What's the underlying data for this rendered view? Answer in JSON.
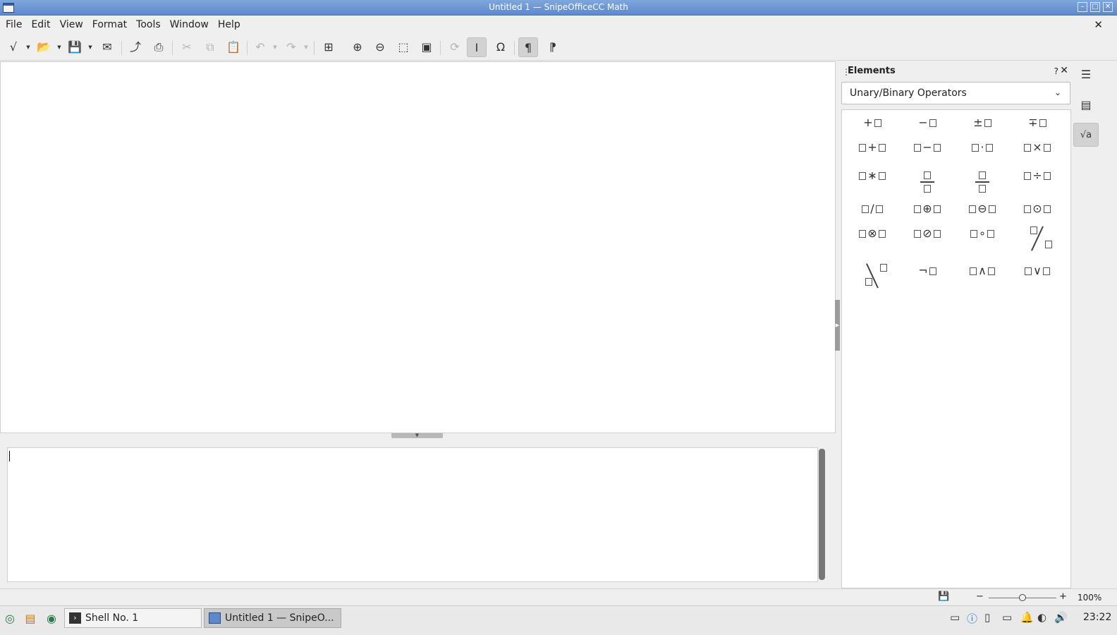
{
  "window": {
    "title": "Untitled 1 — SnipeOfficeCC Math",
    "minimize_icon": "minimize-icon",
    "maximize_icon": "maximize-icon",
    "close_icon": "close-icon"
  },
  "menu": {
    "items": [
      "File",
      "Edit",
      "View",
      "Format",
      "Tools",
      "Window",
      "Help"
    ],
    "close_document_glyph": "✕"
  },
  "toolbar": {
    "buttons": [
      {
        "name": "formula-icon",
        "glyph": "√"
      },
      {
        "name": "open-icon",
        "glyph": "📂"
      },
      {
        "name": "save-icon",
        "glyph": "💾"
      },
      {
        "name": "email-icon",
        "glyph": "✉"
      },
      {
        "name": "export-pdf-icon",
        "glyph": "⤴"
      },
      {
        "name": "print-icon",
        "glyph": "⎙"
      },
      {
        "name": "cut-icon",
        "glyph": "✂"
      },
      {
        "name": "copy-icon",
        "glyph": "⧉"
      },
      {
        "name": "paste-icon",
        "glyph": "📋"
      },
      {
        "name": "undo-icon",
        "glyph": "↶"
      },
      {
        "name": "redo-icon",
        "glyph": "↷"
      },
      {
        "name": "zoom-in-icon",
        "glyph": "⊕"
      },
      {
        "name": "zoom-out-icon",
        "glyph": "⊖"
      },
      {
        "name": "show-all-icon",
        "glyph": "⬚"
      },
      {
        "name": "fit-icon",
        "glyph": "▣"
      },
      {
        "name": "update-icon",
        "glyph": "⟳"
      },
      {
        "name": "formula-cursor-icon",
        "glyph": "I"
      },
      {
        "name": "symbols-icon",
        "glyph": "Ω"
      },
      {
        "name": "paragraph-ltr-icon",
        "glyph": "¶"
      },
      {
        "name": "paragraph-rtl-icon",
        "glyph": "¶"
      }
    ]
  },
  "elements_panel": {
    "grip": "⋮",
    "title": "Elements",
    "help": "?",
    "close": "✕",
    "category": "Unary/Binary Operators",
    "dropdown_arrow": "⌄",
    "operators": [
      {
        "kind": "unary",
        "op": "+"
      },
      {
        "kind": "unary",
        "op": "−"
      },
      {
        "kind": "unary",
        "op": "±"
      },
      {
        "kind": "unary",
        "op": "∓"
      },
      {
        "kind": "binary",
        "op": "+"
      },
      {
        "kind": "binary",
        "op": "−"
      },
      {
        "kind": "binary",
        "op": "·"
      },
      {
        "kind": "binary",
        "op": "×"
      },
      {
        "kind": "binary",
        "op": "∗"
      },
      {
        "kind": "fraction",
        "op": ""
      },
      {
        "kind": "fraction",
        "op": ""
      },
      {
        "kind": "binary",
        "op": "÷"
      },
      {
        "kind": "binary",
        "op": "/"
      },
      {
        "kind": "binary",
        "op": "⊕"
      },
      {
        "kind": "binary",
        "op": "⊖"
      },
      {
        "kind": "binary",
        "op": "⊙"
      },
      {
        "kind": "binary",
        "op": "⊗"
      },
      {
        "kind": "binary",
        "op": "⊘"
      },
      {
        "kind": "binary",
        "op": "∘"
      },
      {
        "kind": "wideslash",
        "op": ""
      },
      {
        "kind": "widebackslash",
        "op": ""
      },
      {
        "kind": "unary",
        "op": "¬"
      },
      {
        "kind": "binary",
        "op": "∧"
      },
      {
        "kind": "binary",
        "op": "∨"
      }
    ]
  },
  "sidebar": {
    "tabs": [
      {
        "name": "sidebar-menu-icon",
        "glyph": "☰",
        "active": false
      },
      {
        "name": "properties-icon",
        "glyph": "▤",
        "active": false
      },
      {
        "name": "elements-icon",
        "glyph": "√a",
        "active": true
      }
    ]
  },
  "statusbar": {
    "save_glyph": "💾",
    "zoom_minus": "−",
    "zoom_plus": "+",
    "zoom_value": "100%",
    "zoom_level": 0.5
  },
  "taskbar": {
    "tasks": [
      {
        "label": "Shell No. 1",
        "icon": "terminal-icon",
        "active": false
      },
      {
        "label": "Untitled 1 — SnipeO...",
        "icon": "window-icon",
        "active": true
      }
    ],
    "clock": "23:22"
  }
}
